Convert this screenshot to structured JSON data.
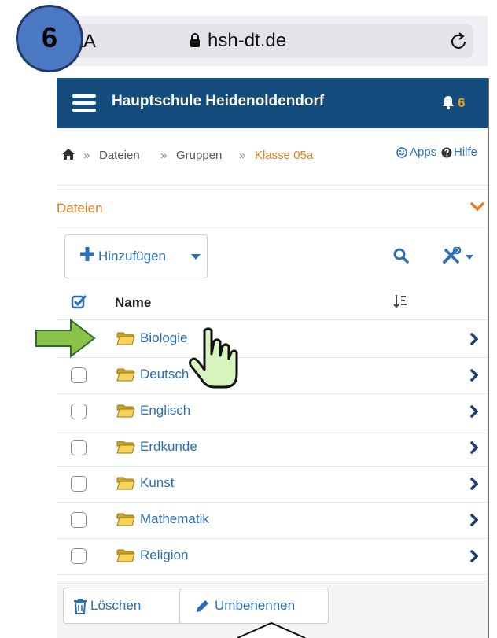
{
  "step_badge": "6",
  "browser": {
    "text_size_button": "AA",
    "url": "hsh-dt.de",
    "reload_icon": "reload-icon",
    "lock_icon": "lock-icon"
  },
  "navbar": {
    "title": "Hauptschule Heidenoldendorf",
    "notification_count": "6"
  },
  "breadcrumb": {
    "home_icon": "home-icon",
    "separator": "»",
    "items": [
      "Dateien",
      "Gruppen",
      "Klasse 05a"
    ],
    "apps": "Apps",
    "help": "Hilfe"
  },
  "section": {
    "title": "Dateien"
  },
  "toolbar": {
    "add_label": "Hinzufügen"
  },
  "table": {
    "name_header": "Name"
  },
  "files": [
    {
      "name": "Biologie"
    },
    {
      "name": "Deutsch"
    },
    {
      "name": "Englisch"
    },
    {
      "name": "Erdkunde"
    },
    {
      "name": "Kunst"
    },
    {
      "name": "Mathematik"
    },
    {
      "name": "Religion"
    }
  ],
  "footer": {
    "delete_label": "Löschen",
    "rename_label": "Umbenennen"
  },
  "colors": {
    "navbar": "#154c7e",
    "link": "#2a6fb5",
    "accent": "#e67e22",
    "badge": "#4a78c2",
    "arrow": "#8bc34a"
  }
}
